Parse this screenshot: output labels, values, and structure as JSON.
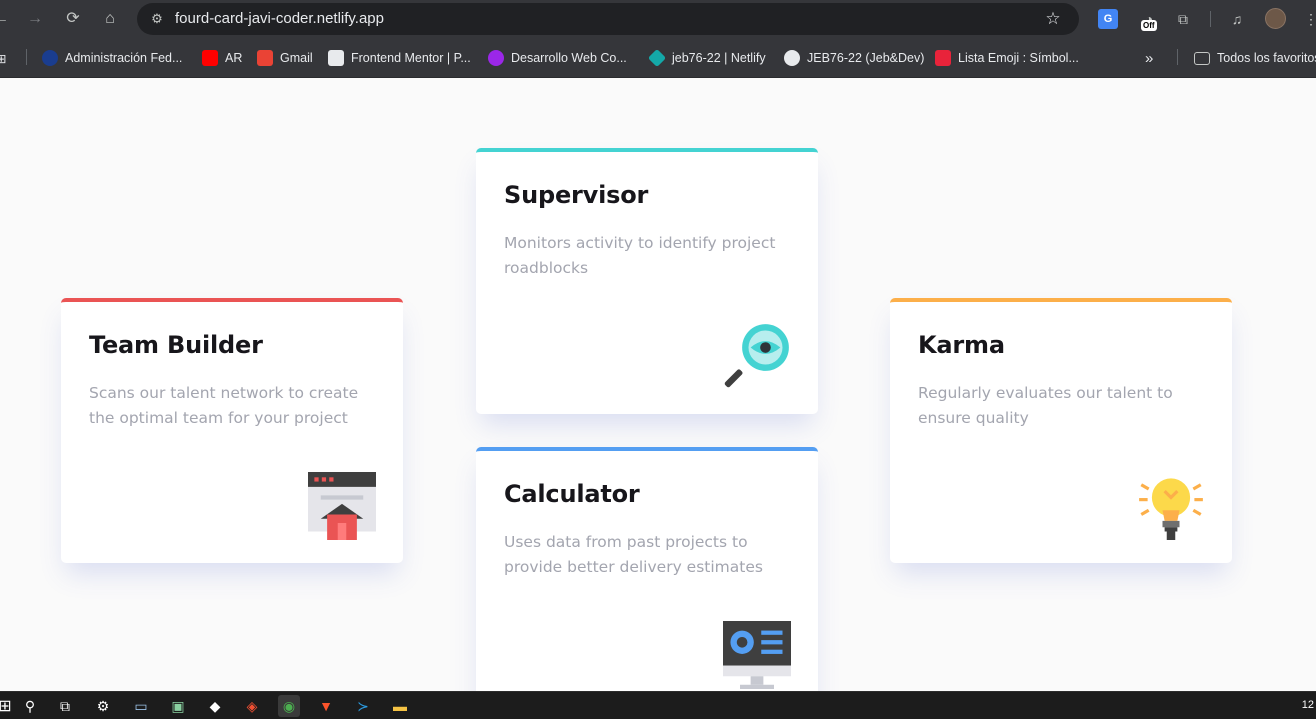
{
  "browser": {
    "url": "fourd-card-javi-coder.netlify.app",
    "translate_badge": "Off",
    "bookmarks": [
      {
        "label": "Administración Fed...",
        "color": "#1a3d8f"
      },
      {
        "label": "AR",
        "color": "#ff0000"
      },
      {
        "label": "Gmail",
        "color": "#ea4335"
      },
      {
        "label": "Frontend Mentor | P...",
        "color": "#e8eaed"
      },
      {
        "label": "Desarrollo Web Co...",
        "color": "#9b27e8"
      },
      {
        "label": "jeb76-22 | Netlify",
        "color": "#14a8a8"
      },
      {
        "label": "JEB76-22 (Jeb&Dev)",
        "color": "#e8eaed"
      },
      {
        "label": "Lista Emoji : Símbol...",
        "color": "#e8233a"
      }
    ],
    "overflow": "»",
    "all_bookmarks": "Todos los favoritos"
  },
  "cards": {
    "supervisor": {
      "title": "Supervisor",
      "desc": "Monitors activity to identify project roadblocks",
      "icon": "magnifier-eye-icon",
      "accent": "#44d3d2"
    },
    "team_builder": {
      "title": "Team Builder",
      "desc": "Scans our talent network to create the optimal team for your project",
      "icon": "team-builder-icon",
      "accent": "#ea5454"
    },
    "karma": {
      "title": "Karma",
      "desc": "Regularly evaluates our talent to ensure quality",
      "icon": "lightbulb-icon",
      "accent": "#fcaf4a"
    },
    "calculator": {
      "title": "Calculator",
      "desc": "Uses data from past projects to provide better delivery estimates",
      "icon": "calculator-monitor-icon",
      "accent": "#549ef2"
    }
  },
  "taskbar": {
    "clock": "12"
  }
}
